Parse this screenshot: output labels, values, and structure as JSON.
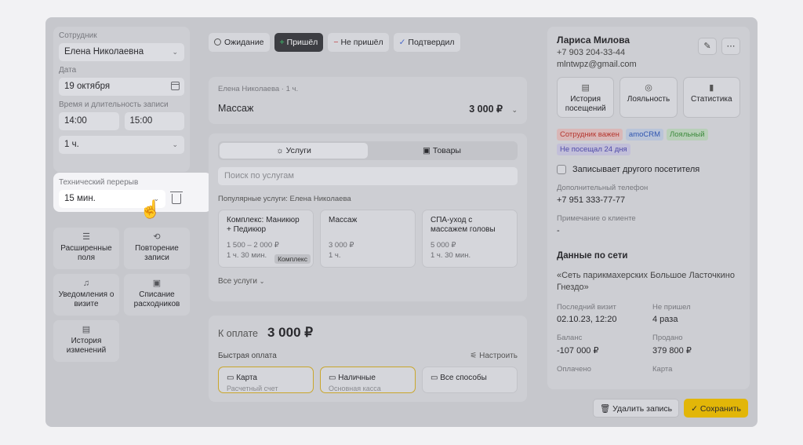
{
  "left": {
    "employee_label": "Сотрудник",
    "employee_value": "Елена Николаевна",
    "date_label": "Дата",
    "date_value": "19 октября",
    "time_label": "Время и длительность записи",
    "time_start": "14:00",
    "time_end": "15:00",
    "duration": "1 ч.",
    "break_label": "Технический перерыв",
    "break_value": "15 мин.",
    "tiles": [
      {
        "label": "Расширенные поля",
        "icon": "list-icon"
      },
      {
        "label": "Повторение записи",
        "icon": "repeat-icon"
      },
      {
        "label": "Уведомления о визите",
        "icon": "bell-icon"
      },
      {
        "label": "Списание расходников",
        "icon": "box-icon"
      },
      {
        "label": "История изменений",
        "icon": "archive-icon"
      }
    ]
  },
  "statuses": {
    "waiting": "Ожидание",
    "came": "Пришёл",
    "not_came": "Не пришёл",
    "confirmed": "Подтвердил"
  },
  "service": {
    "subtitle": "Елена Николаева · 1 ч.",
    "name": "Массаж",
    "price": "3 000 ₽"
  },
  "services": {
    "tab_services": "Услуги",
    "tab_goods": "Товары",
    "search_placeholder": "Поиск по услугам",
    "popular_label": "Популярные услуги: Елена Николаева",
    "cards": [
      {
        "name": "Комплекс: Маникюр + Педикюр",
        "price": "1 500 – 2 000 ₽",
        "duration": "1 ч. 30 мин.",
        "badge": "Комплекс"
      },
      {
        "name": "Массаж",
        "price": "3 000 ₽",
        "duration": "1 ч.",
        "badge": ""
      },
      {
        "name": "СПА-уход с массажем головы",
        "price": "5 000 ₽",
        "duration": "1 ч. 30 мин.",
        "badge": ""
      }
    ],
    "all_services": "Все услуги"
  },
  "payment": {
    "label": "К оплате",
    "amount": "3 000 ₽",
    "quick_label": "Быстрая оплата",
    "configure": "Настроить",
    "methods": [
      {
        "label": "Карта",
        "sub": "Расчетный счет"
      },
      {
        "label": "Наличные",
        "sub": "Основная касса"
      },
      {
        "label": "Все способы",
        "sub": ""
      }
    ]
  },
  "client": {
    "name": "Лариса Милова",
    "phone": "+7 903 204-33-44",
    "email": "mlntwpz@gmail.com",
    "buttons": {
      "history": "История посещений",
      "loyalty": "Лояльность",
      "stats": "Статистика"
    },
    "tags": [
      "Сотрудник важен",
      "amoCRM",
      "Лояльный",
      "Не посещал 24 дня"
    ],
    "books_other": "Записывает другого посетителя",
    "extra_phone_label": "Дополнительный телефон",
    "extra_phone": "+7 951 333-77-77",
    "note_label": "Примечание о клиенте",
    "note": "-",
    "network_title": "Данные по сети",
    "network_name": "«Сеть парикмахерских Большое Ласточкино Гнездо»",
    "last_visit_label": "Последний визит",
    "last_visit": "02.10.23, 12:20",
    "not_came_label": "Не пришел",
    "not_came": "4 раза",
    "balance_label": "Баланс",
    "balance": "-107 000 ₽",
    "sold_label": "Продано",
    "sold": "379 800 ₽",
    "paid_label": "Оплачено",
    "card_label": "Карта"
  },
  "footer": {
    "delete": "Удалить запись",
    "save": "Сохранить"
  },
  "colors": {
    "accent": "#e2b608",
    "came": "#3c9a5f",
    "not_came": "#c2484c",
    "confirmed": "#4a68c9"
  }
}
